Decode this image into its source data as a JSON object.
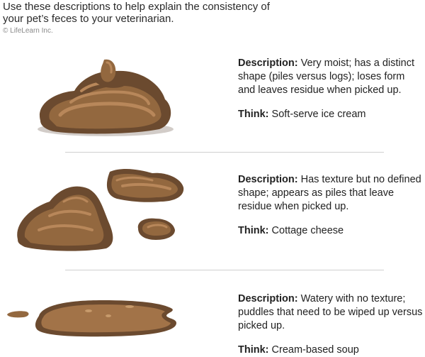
{
  "header": {
    "intro": "Use these descriptions to help explain the consistency of your pet’s feces to your veterinarian.",
    "copyright": "© LifeLearn Inc."
  },
  "entries": [
    {
      "description_label": "Description:",
      "description_text": " Very moist; has a distinct shape (piles versus logs); loses form and leaves residue when picked up.",
      "think_label": "Think:",
      "think_text": " Soft-serve ice cream",
      "illustration": "soft-serve-stool-illustration"
    },
    {
      "description_label": "Description:",
      "description_text": " Has texture but no defined shape; appears as piles that leave residue when picked up.",
      "think_label": "Think:",
      "think_text": " Cottage cheese",
      "illustration": "cottage-cheese-stool-illustration"
    },
    {
      "description_label": "Description:",
      "description_text": " Watery with no texture; puddles that need to be wiped up versus picked up.",
      "think_label": "Think:",
      "think_text": " Cream-based soup",
      "illustration": "watery-stool-illustration"
    }
  ],
  "colors": {
    "stool_dark": "#6b4a2f",
    "stool_mid": "#93683f",
    "stool_light": "#b8875a",
    "divider": "#cfcfcf"
  }
}
